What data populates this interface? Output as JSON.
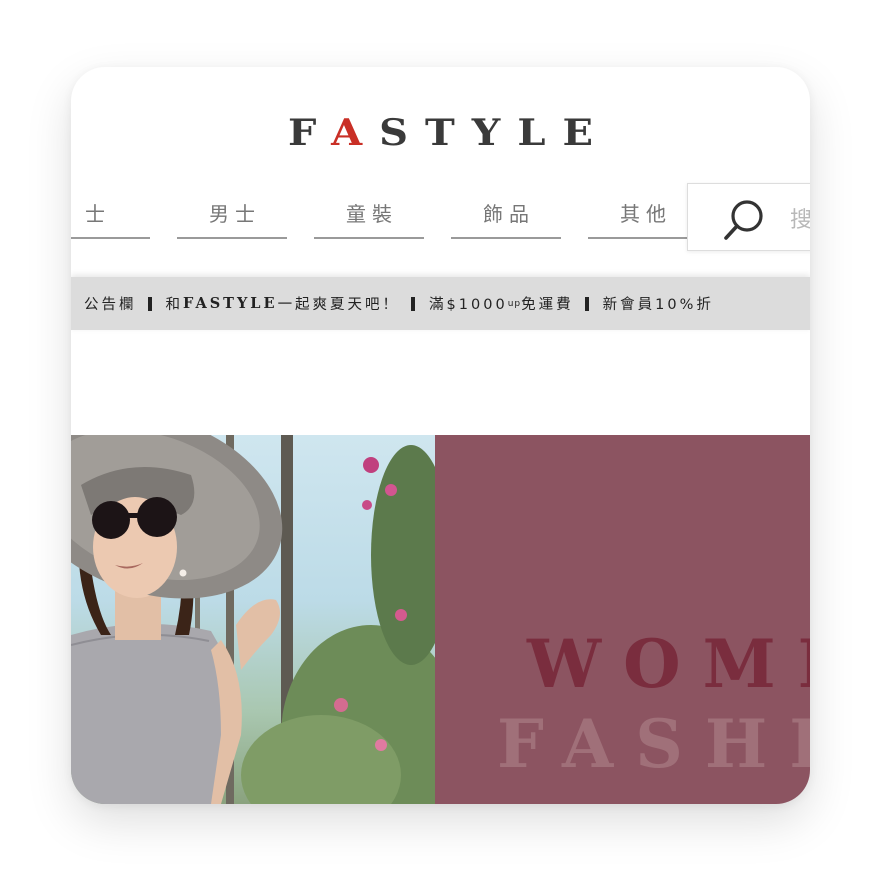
{
  "logo": {
    "before": "F",
    "accent": "A",
    "after": "STYLE"
  },
  "nav": {
    "items": [
      {
        "label": "士"
      },
      {
        "label": "男士"
      },
      {
        "label": "童裝"
      },
      {
        "label": "飾品"
      },
      {
        "label": "其他"
      }
    ]
  },
  "search": {
    "placeholder": "搜",
    "icon": "search-icon"
  },
  "announcement": {
    "part1": "公告欄",
    "part2_prefix": "和",
    "part2_brand": "FASTYLE",
    "part2_suffix": "一起爽夏天吧！",
    "part3_prefix": "滿$1000",
    "part3_small": "up",
    "part3_suffix": "免運費",
    "part4": "新會員10%折"
  },
  "hero": {
    "word1": "WOMEN",
    "word2": "FASHION"
  },
  "colors": {
    "accent": "#c92f26",
    "panel": "#8c5461",
    "announce_bg": "#dcdcdc",
    "text": "#3a3a3a"
  }
}
